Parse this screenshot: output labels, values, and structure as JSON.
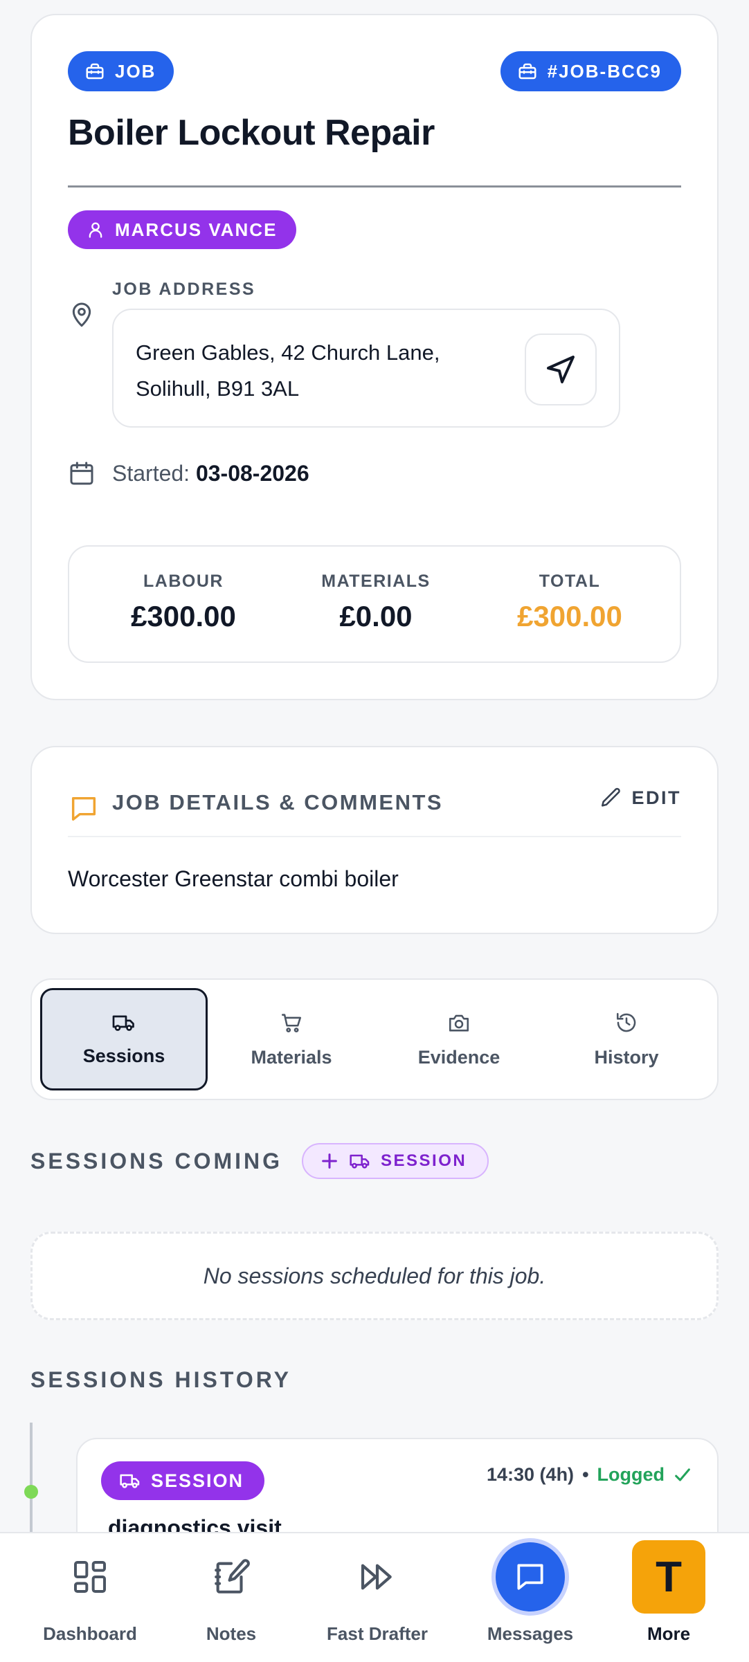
{
  "job": {
    "type_label": "JOB",
    "id_label": "#JOB-BCC9",
    "title": "Boiler Lockout Repair",
    "customer_name": "MARCUS VANCE",
    "address_label": "JOB ADDRESS",
    "address": "Green Gables, 42 Church Lane, Solihull, B91 3AL",
    "started_label": "Started:",
    "started_date": "03-08-2026",
    "totals": {
      "labour_label": "LABOUR",
      "labour_value": "£300.00",
      "materials_label": "MATERIALS",
      "materials_value": "£0.00",
      "total_label": "TOTAL",
      "total_value": "£300.00"
    }
  },
  "details": {
    "title": "JOB DETAILS & COMMENTS",
    "edit_label": "EDIT",
    "text": "Worcester Greenstar combi boiler"
  },
  "tabs": [
    {
      "label": "Sessions",
      "icon": "van-icon",
      "active": true
    },
    {
      "label": "Materials",
      "icon": "cart-icon",
      "active": false
    },
    {
      "label": "Evidence",
      "icon": "camera-icon",
      "active": false
    },
    {
      "label": "History",
      "icon": "history-icon",
      "active": false
    }
  ],
  "sessions_coming": {
    "heading": "SESSIONS COMING",
    "add_label": "SESSION",
    "empty_text": "No sessions scheduled for this job."
  },
  "sessions_history": {
    "heading": "SESSIONS HISTORY",
    "items": [
      {
        "badge": "SESSION",
        "time": "14:30 (4h)",
        "separator": "•",
        "status": "Logged",
        "name": "diagnostics visit"
      }
    ]
  },
  "bottom_nav": [
    {
      "label": "Dashboard",
      "icon": "dashboard-icon"
    },
    {
      "label": "Notes",
      "icon": "notes-icon"
    },
    {
      "label": "Fast Drafter",
      "icon": "fast-forward-icon"
    },
    {
      "label": "Messages",
      "icon": "message-icon"
    },
    {
      "label": "More",
      "icon": "avatar-letter",
      "letter": "T"
    }
  ],
  "colors": {
    "primary": "#2563eb",
    "purple": "#9333ea",
    "accent": "#f0a431",
    "success": "#22a35a",
    "more_bg": "#f5a30a"
  }
}
